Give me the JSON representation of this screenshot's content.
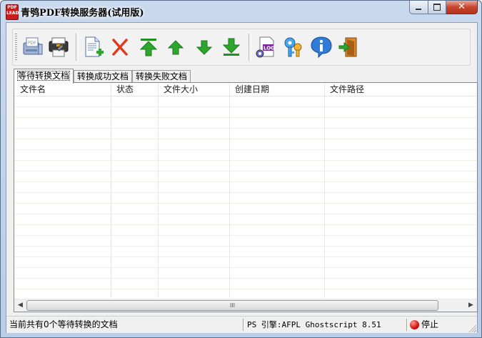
{
  "window": {
    "title": "青鸮PDF转换服务器(试用版)",
    "icon_text": [
      "PDF",
      "LEAD"
    ],
    "icons": {
      "minimize": "minimize-icon",
      "maximize": "maximize-icon",
      "close": "close-icon"
    },
    "close_glyph": "✕"
  },
  "toolbar": {
    "buttons": [
      {
        "name": "pdf-printer-icon"
      },
      {
        "name": "settings-printer-icon"
      },
      {
        "name": "add-document-icon"
      },
      {
        "name": "delete-icon"
      },
      {
        "name": "move-top-icon"
      },
      {
        "name": "move-up-icon"
      },
      {
        "name": "move-down-icon"
      },
      {
        "name": "move-bottom-icon"
      },
      {
        "name": "log-icon"
      },
      {
        "name": "register-key-icon"
      },
      {
        "name": "about-info-icon"
      },
      {
        "name": "exit-icon"
      }
    ],
    "colors": {
      "arrow_green": "#2ea62e",
      "delete_red": "#e03a1e"
    }
  },
  "tabs": [
    {
      "label": "等待转换文档",
      "active": true
    },
    {
      "label": "转换成功文档",
      "active": false
    },
    {
      "label": "转换失败文档",
      "active": false
    }
  ],
  "table": {
    "columns": [
      "文件名",
      "状态",
      "文件大小",
      "创建日期",
      "文件路径"
    ],
    "rows": []
  },
  "scrollbar": {
    "left_arrow": "◀",
    "right_arrow": "▶",
    "grip": "III"
  },
  "statusbar": {
    "message": "当前共有0个等待转换的文档",
    "engine": "PS 引擎:AFPL Ghostscript 8.51",
    "state": "停止",
    "state_color": "#d41010"
  }
}
